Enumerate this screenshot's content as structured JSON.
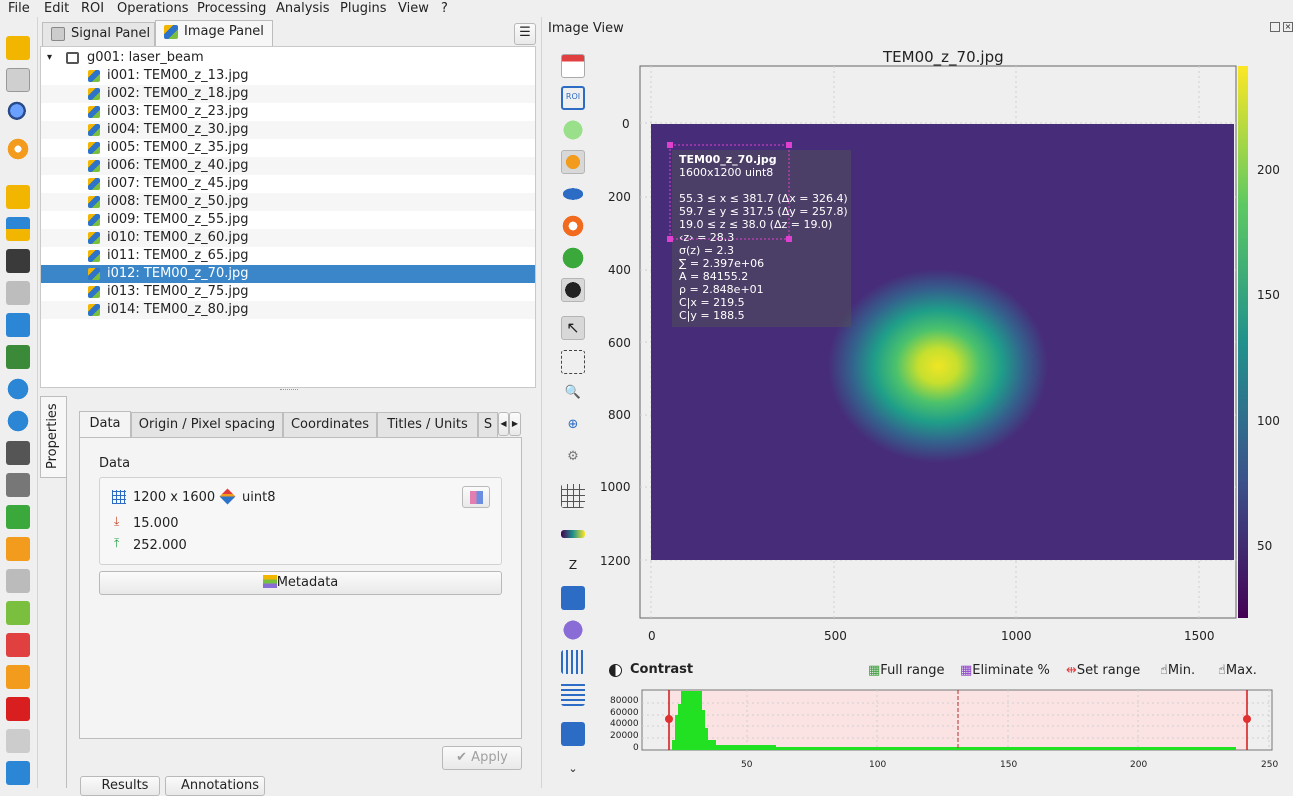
{
  "menu": [
    "File",
    "Edit",
    "ROI",
    "Operations",
    "Processing",
    "Analysis",
    "Plugins",
    "View",
    "?"
  ],
  "tabs": {
    "signal": "Signal Panel",
    "image": "Image Panel"
  },
  "tree": {
    "group": "g001: laser_beam",
    "items": [
      "i001: TEM00_z_13.jpg",
      "i002: TEM00_z_18.jpg",
      "i003: TEM00_z_23.jpg",
      "i004: TEM00_z_30.jpg",
      "i005: TEM00_z_35.jpg",
      "i006: TEM00_z_40.jpg",
      "i007: TEM00_z_45.jpg",
      "i008: TEM00_z_50.jpg",
      "i009: TEM00_z_55.jpg",
      "i010: TEM00_z_60.jpg",
      "i011: TEM00_z_65.jpg",
      "i012: TEM00_z_70.jpg",
      "i013: TEM00_z_75.jpg",
      "i014: TEM00_z_80.jpg"
    ],
    "selected_index": 11
  },
  "properties": {
    "side_label": "Properties",
    "tabs": [
      "Data",
      "Origin / Pixel spacing",
      "Coordinates",
      "Titles / Units",
      "S"
    ],
    "group_title": "Data",
    "size": "1200 x 1600",
    "dtype": "uint8",
    "min": "15.000",
    "max": "252.000",
    "metadata_button": "Metadata",
    "apply_button": "Apply",
    "bottom_tabs": [
      "Results",
      "Annotations"
    ]
  },
  "image_view": {
    "dock_title": "Image View",
    "plot_title": "TEM00_z_70.jpg",
    "annotation": {
      "title": "TEM00_z_70.jpg",
      "subtitle": "1600x1200 uint8",
      "lines": [
        "55.3 ≤ x ≤ 381.7 (Δx = 326.4)",
        "59.7 ≤ y ≤ 317.5 (Δy = 257.8)",
        "19.0 ≤ z ≤ 38.0 (Δz = 19.0)",
        "‹z› = 28.3",
        "σ(z) = 2.3",
        "∑ = 2.397e+06",
        "A = 84155.2",
        "ρ = 2.848e+01",
        "C|x = 219.5",
        "C|y = 188.5"
      ]
    },
    "x_ticks": [
      "0",
      "500",
      "1000",
      "1500"
    ],
    "y_ticks": [
      "0",
      "200",
      "400",
      "600",
      "800",
      "1000",
      "1200"
    ],
    "colorbar_ticks": [
      "200",
      "150",
      "100",
      "50"
    ],
    "colormap": "viridis"
  },
  "contrast": {
    "title": "Contrast",
    "buttons": [
      "Full range",
      "Eliminate %",
      "Set range",
      "Min.",
      "Max."
    ],
    "y_ticks": [
      "80000",
      "60000",
      "40000",
      "20000",
      "0"
    ],
    "x_ticks": [
      "50",
      "100",
      "150",
      "200",
      "250"
    ]
  },
  "colors": {
    "selection": "#3a86c8",
    "accent_green": "#20e020",
    "range_fill": "#fbe3e3"
  }
}
